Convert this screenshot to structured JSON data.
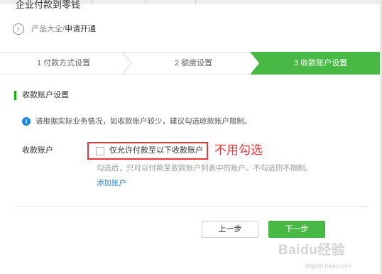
{
  "page": {
    "title": "企业付款到零钱"
  },
  "breadcrumb": {
    "parent": "产品大全",
    "separator": "/",
    "current": "申请开通"
  },
  "steps": [
    {
      "label": "1 付款方式设置",
      "active": false
    },
    {
      "label": "2 额度设置",
      "active": false
    },
    {
      "label": "3 收款账户设置",
      "active": true
    }
  ],
  "section": {
    "title": "收款账户设置",
    "tip": "请根据实际业务情况，如收款账户较少，建议勾选收款账户限制。"
  },
  "form": {
    "field_label": "收款账户",
    "checkbox_label": "仅允许付款至以下收款账户",
    "checkbox_checked": false,
    "helper_text": "勾选后，只可以付款至收款账户列表中的账户。不勾选则不限制。",
    "add_link": "添加账户"
  },
  "annotation": {
    "text": "不用勾选",
    "color": "#e4393c"
  },
  "buttons": {
    "prev": "上一步",
    "next": "下一步"
  },
  "colors": {
    "accent": "#09bb07",
    "active_step": "#49b946",
    "link": "#2f86d6",
    "info_icon": "#1a88e0"
  },
  "watermark": {
    "brand": "Baidu经验",
    "url": "jingyan.baidu.com"
  }
}
